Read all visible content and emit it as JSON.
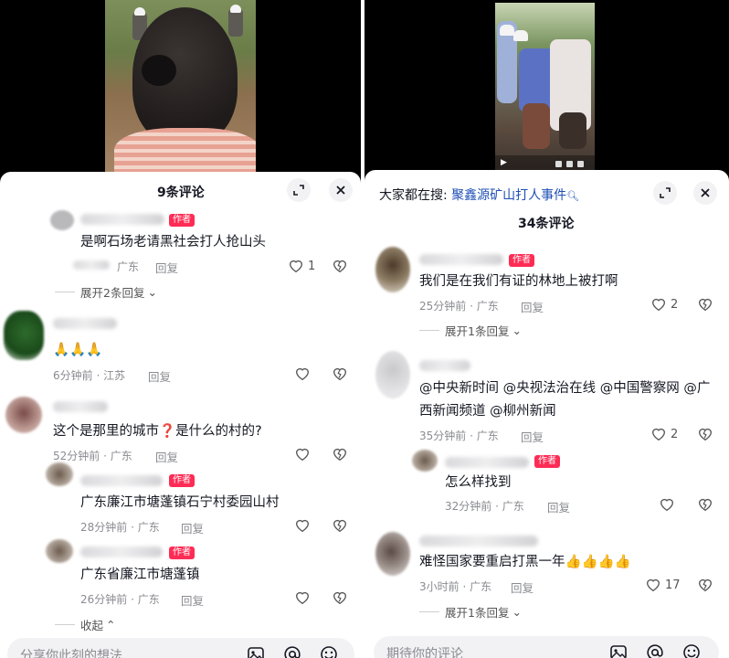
{
  "left": {
    "title": "9条评论",
    "comments": [
      {
        "text": "是啊石场老请黑社会打人抢山头",
        "author_tag": "作者",
        "meta": "广东",
        "reply": "回复",
        "likes": "1",
        "expand": "展开2条回复"
      },
      {
        "text": "🙏🙏🙏",
        "meta": "6分钟前 · 江苏",
        "reply": "回复"
      },
      {
        "text_before": "这个是那里的城市",
        "text_q": "❓",
        "text_after": "是什么的村的?",
        "meta": "52分钟前 · 广东",
        "reply": "回复"
      },
      {
        "text": "广东廉江市塘蓬镇石宁村委园山村",
        "author_tag": "作者",
        "meta": "28分钟前 · 广东",
        "reply": "回复"
      },
      {
        "text": "广东省廉江市塘蓬镇",
        "author_tag": "作者",
        "meta": "26分钟前 · 广东",
        "reply": "回复"
      }
    ],
    "collapse": "收起",
    "input_placeholder": "分享你此刻的想法"
  },
  "right": {
    "search_prefix": "大家都在搜:",
    "search_term": "聚鑫源矿山打人事件",
    "title": "34条评论",
    "comments": [
      {
        "text": "我们是在我们有证的林地上被打啊",
        "author_tag": "作者",
        "meta": "25分钟前 · 广东",
        "reply": "回复",
        "likes": "2",
        "expand": "展开1条回复"
      },
      {
        "text_line1": "@中央新时间 @央视法治在线 @中国警察网 @广",
        "text_line2": "西新闻频道 @柳州新闻",
        "meta": "35分钟前 · 广东",
        "reply": "回复",
        "likes": "2"
      },
      {
        "text": "怎么样找到",
        "author_tag": "作者",
        "meta": "32分钟前 · 广东",
        "reply": "回复"
      },
      {
        "text": "难怪国家要重启打黑一年👍👍👍👍",
        "meta": "3小时前 · 广东",
        "reply": "回复",
        "likes": "17",
        "expand": "展开1条回复"
      }
    ],
    "input_placeholder": "期待你的评论"
  },
  "icons": {
    "expand": "expand-icon",
    "close": "close-icon",
    "like": "heart-icon",
    "dislike": "broken-heart-icon",
    "image": "image-icon",
    "mention": "at-icon",
    "emoji": "emoji-icon"
  },
  "colors": {
    "author_tag": "#fe2c55",
    "search_term": "#1e4fb4",
    "meta": "#8a8b91"
  }
}
